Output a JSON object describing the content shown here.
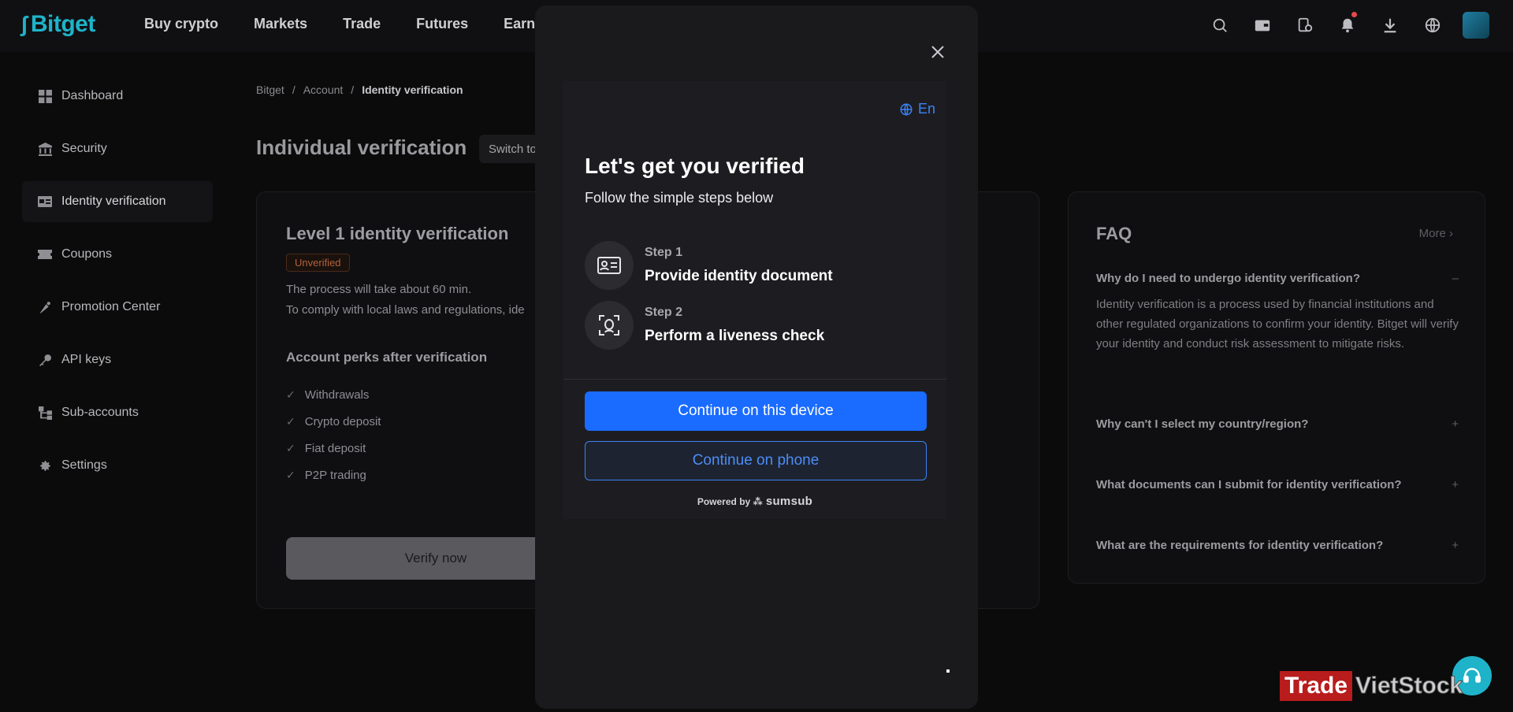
{
  "brand": {
    "name": "Bitget",
    "accent": "#1fb3c9"
  },
  "nav": {
    "links": [
      "Buy crypto",
      "Markets",
      "Trade",
      "Futures",
      "Earn"
    ]
  },
  "topicons": [
    "search-icon",
    "wallet-icon",
    "orders-icon",
    "bell-icon",
    "download-icon",
    "globe-icon"
  ],
  "sidebar": {
    "items": [
      {
        "label": "Dashboard",
        "icon": "dashboard-icon"
      },
      {
        "label": "Security",
        "icon": "bank-icon"
      },
      {
        "label": "Identity verification",
        "icon": "id-card-icon"
      },
      {
        "label": "Coupons",
        "icon": "ticket-icon"
      },
      {
        "label": "Promotion Center",
        "icon": "megaphone-icon"
      },
      {
        "label": "API keys",
        "icon": "key-icon"
      },
      {
        "label": "Sub-accounts",
        "icon": "hierarchy-icon"
      },
      {
        "label": "Settings",
        "icon": "gear-icon"
      }
    ]
  },
  "breadcrumb": {
    "root": "Bitget",
    "mid": "Account",
    "current": "Identity verification"
  },
  "page": {
    "title": "Individual verification",
    "switch": "Switch to"
  },
  "card": {
    "title": "Level 1 identity verification",
    "badge": "Unverified",
    "line1": "The process will take about 60 min.",
    "line2": "To comply with local laws and regulations, ide",
    "perks_title": "Account perks after verification",
    "perks": [
      "Withdrawals",
      "Crypto deposit",
      "Fiat deposit",
      "P2P trading"
    ],
    "verify": "Verify now"
  },
  "faq": {
    "title": "FAQ",
    "more": "More",
    "q1": "Why do I need to undergo identity verification?",
    "a1": "Identity verification is a process used by financial institutions and other regulated organizations to confirm your identity. Bitget will verify your identity and conduct risk assessment to mitigate risks.",
    "q2": "Why can't I select my country/region?",
    "q3": "What documents can I submit for identity verification?",
    "q4": "What are the requirements for identity verification?"
  },
  "modal": {
    "lang": "En",
    "title": "Let's get you verified",
    "subtitle": "Follow the simple steps below",
    "step1_label": "Step 1",
    "step1_text": "Provide identity document",
    "step2_label": "Step 2",
    "step2_text": "Perform a liveness check",
    "primary": "Continue on this device",
    "secondary": "Continue on phone",
    "powered": "Powered by",
    "powered_brand": "sumsub"
  },
  "watermark": {
    "red": "Trade",
    "rest": "VietStock"
  }
}
